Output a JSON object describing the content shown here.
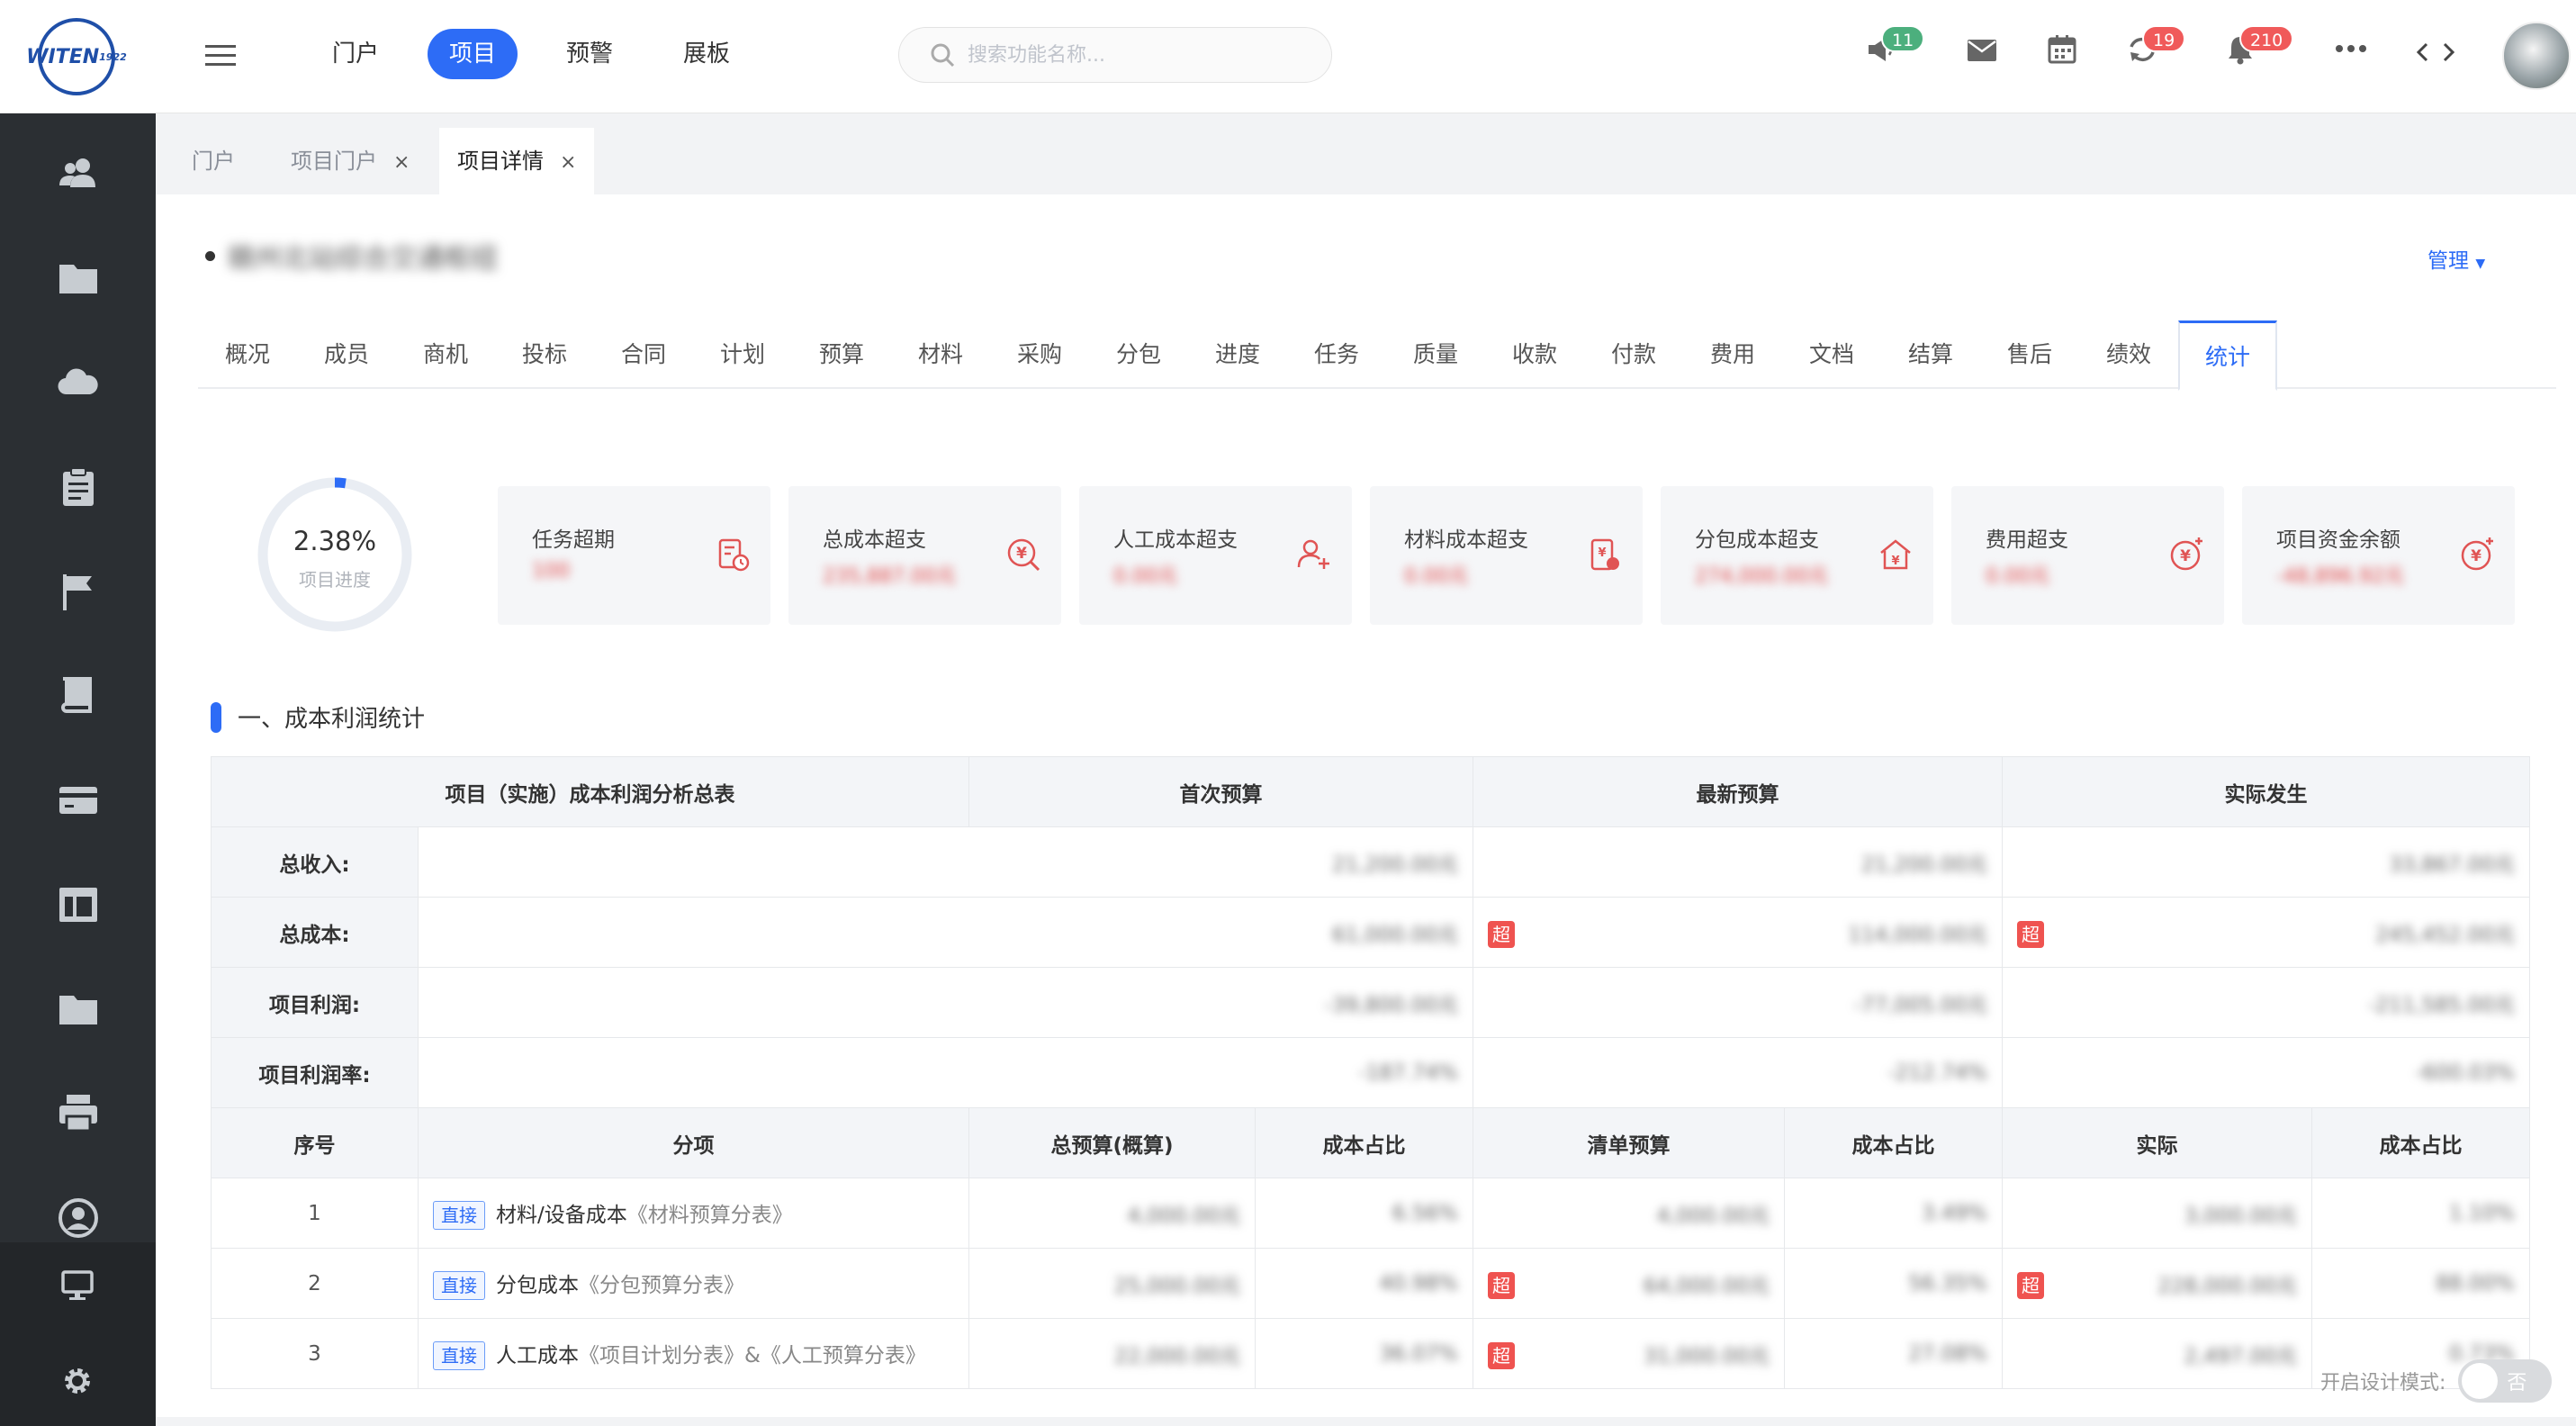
{
  "header": {
    "logo_text": "WITEN",
    "logo_sub": "1922",
    "nav": [
      {
        "label": "门户",
        "active": false
      },
      {
        "label": "项目",
        "active": true
      },
      {
        "label": "预警",
        "active": false
      },
      {
        "label": "展板",
        "active": false
      }
    ],
    "search_placeholder": "搜索功能名称...",
    "badges": {
      "announce": "11",
      "sync": "19",
      "notify": "210"
    },
    "colors": {
      "accent": "#2d6cf6",
      "green_badge": "#4caf7d",
      "red_badge": "#f05a5a",
      "danger": "#e04848"
    }
  },
  "sidebar": {
    "icons": [
      "users-icon",
      "folder-icon",
      "cloud-icon",
      "clipboard-icon",
      "flag-icon",
      "book-icon",
      "card-icon",
      "layout-icon",
      "folder2-icon",
      "printer-icon",
      "user-circle-icon",
      "monitor-icon",
      "gear-icon"
    ]
  },
  "tabs": [
    {
      "label": "门户",
      "closable": false,
      "active": false
    },
    {
      "label": "项目门户",
      "closable": true,
      "active": false
    },
    {
      "label": "项目详情",
      "closable": true,
      "active": true
    }
  ],
  "project": {
    "name": "赣州北站综合交通枢纽",
    "manage_label": "管理"
  },
  "subtabs": [
    "概况",
    "成员",
    "商机",
    "投标",
    "合同",
    "计划",
    "预算",
    "材料",
    "采购",
    "分包",
    "进度",
    "任务",
    "质量",
    "收款",
    "付款",
    "费用",
    "文档",
    "结算",
    "售后",
    "绩效",
    "统计"
  ],
  "active_subtab": "统计",
  "progress": {
    "value": "2.38%",
    "fraction": 0.0238,
    "label": "项目进度"
  },
  "cards": [
    {
      "label": "任务超期",
      "value": "100",
      "icon": "doc-clock-icon"
    },
    {
      "label": "总成本超支",
      "value": "235,887.00元",
      "icon": "yen-search-icon"
    },
    {
      "label": "人工成本超支",
      "value": "0.00元",
      "icon": "user-add-icon"
    },
    {
      "label": "材料成本超支",
      "value": "0.00元",
      "icon": "doc-money-icon"
    },
    {
      "label": "分包成本超支",
      "value": "274,000.00元",
      "icon": "house-yen-icon"
    },
    {
      "label": "费用超支",
      "value": "0.00元",
      "icon": "yen-plus-icon"
    },
    {
      "label": "项目资金余额",
      "value": "-48,896.92元",
      "icon": "yen-plus2-icon"
    }
  ],
  "section_title": "一、成本利润统计",
  "table": {
    "headers": [
      "项目（实施）成本利润分析总表",
      "首次预算",
      "最新预算",
      "实际发生"
    ],
    "summary": [
      {
        "label": "总收入:",
        "first": "21,200.00元",
        "latest": "21,200.00元",
        "actual": "33,867.00元",
        "latest_over": false,
        "actual_over": false
      },
      {
        "label": "总成本:",
        "first": "61,000.00元",
        "latest": "114,000.00元",
        "actual": "245,452.00元",
        "latest_over": true,
        "actual_over": true
      },
      {
        "label": "项目利润:",
        "first": "-39,800.00元",
        "latest": "-77,005.00元",
        "actual": "-211,585.00元",
        "latest_over": false,
        "actual_over": false
      },
      {
        "label": "项目利润率:",
        "first": "-187.74%",
        "latest": "-212.74%",
        "actual": "-600.03%",
        "latest_over": false,
        "actual_over": false
      }
    ],
    "over_label": "超",
    "detail_headers": [
      "序号",
      "分项",
      "总预算(概算)",
      "成本占比",
      "清单预算",
      "成本占比",
      "实际",
      "成本占比"
    ],
    "rows": [
      {
        "no": "1",
        "tag": "直接",
        "name": "材料/设备成本",
        "link": "《材料预算分表》",
        "budget": "4,000.00元",
        "ratio1": "6.56%",
        "list_over": false,
        "list": "4,000.00元",
        "ratio2": "3.49%",
        "actual_over": false,
        "actual": "3,000.00元",
        "ratio3": "1.10%"
      },
      {
        "no": "2",
        "tag": "直接",
        "name": "分包成本",
        "link": "《分包预算分表》",
        "budget": "25,000.00元",
        "ratio1": "40.98%",
        "list_over": true,
        "list": "64,000.00元",
        "ratio2": "56.35%",
        "actual_over": true,
        "actual": "228,000.00元",
        "ratio3": "88.00%"
      },
      {
        "no": "3",
        "tag": "直接",
        "name": "人工成本",
        "link": "《项目计划分表》&《人工预算分表》",
        "budget": "22,000.00元",
        "ratio1": "36.07%",
        "list_over": true,
        "list": "31,000.00元",
        "ratio2": "27.08%",
        "actual_over": false,
        "actual": "2,497.00元",
        "ratio3": "0.73%"
      }
    ]
  },
  "design_mode": {
    "label": "开启设计模式:",
    "value": "否"
  }
}
